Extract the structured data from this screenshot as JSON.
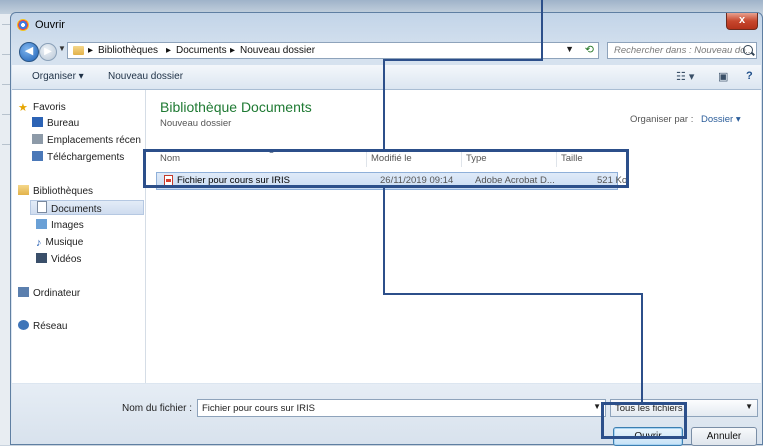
{
  "window": {
    "title": "Ouvrir",
    "close_label": "x"
  },
  "address": {
    "breadcrumbs": [
      "Bibliothèques",
      "Documents",
      "Nouveau dossier"
    ],
    "search_placeholder": "Rechercher dans : Nouveau do..."
  },
  "toolbar": {
    "organize": "Organiser ▾",
    "new_folder": "Nouveau dossier"
  },
  "sidebar": {
    "items": [
      {
        "label": "Favoris",
        "icon": "star-icon"
      },
      {
        "label": "Bureau",
        "icon": "desktop-icon"
      },
      {
        "label": "Emplacements récen",
        "icon": "recent-places-icon"
      },
      {
        "label": "Téléchargements",
        "icon": "downloads-icon"
      },
      {
        "label": "Bibliothèques",
        "icon": "libraries-icon"
      },
      {
        "label": "Documents",
        "icon": "documents-icon",
        "selected": true
      },
      {
        "label": "Images",
        "icon": "images-icon"
      },
      {
        "label": "Musique",
        "icon": "music-icon"
      },
      {
        "label": "Vidéos",
        "icon": "videos-icon"
      },
      {
        "label": "Ordinateur",
        "icon": "computer-icon"
      },
      {
        "label": "Réseau",
        "icon": "network-icon"
      }
    ]
  },
  "content": {
    "library_title": "Bibliothèque Documents",
    "library_subtitle": "Nouveau dossier",
    "arrange_label": "Organiser par :",
    "arrange_value": "Dossier ▾",
    "columns": [
      "Nom",
      "Modifié le",
      "Type",
      "Taille"
    ],
    "files": [
      {
        "name": "Fichier pour cours sur IRIS",
        "modified": "26/11/2019 09:14",
        "type": "Adobe Acrobat D...",
        "size": "521 Ko"
      }
    ]
  },
  "footer": {
    "filename_label": "Nom du fichier :",
    "filename_value": "Fichier pour cours sur IRIS",
    "filetype_value": "Tous les fichiers",
    "open_label": "Ouvrir",
    "cancel_label": "Annuler"
  },
  "colors": {
    "highlight": "#2c4f8a",
    "library_title": "#1f7a33"
  }
}
